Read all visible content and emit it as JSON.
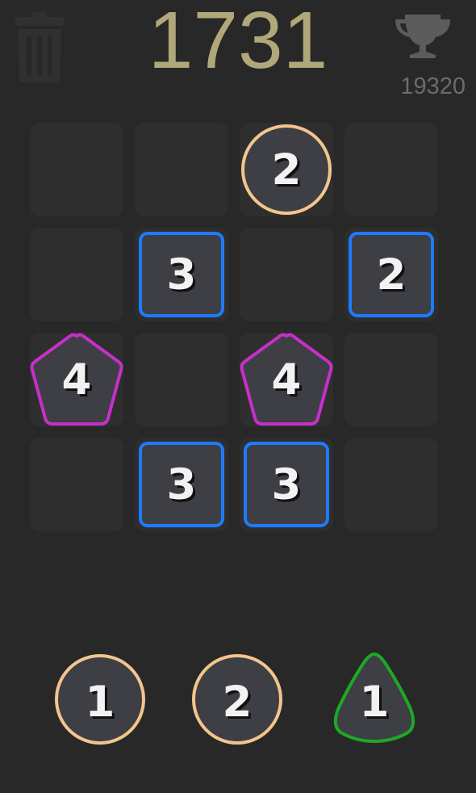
{
  "game": {
    "score": "1731",
    "best_score": "19320"
  },
  "board": {
    "rows": 4,
    "cols": 4,
    "pieces": [
      {
        "row": 0,
        "col": 2,
        "value": "2",
        "shape": "circle"
      },
      {
        "row": 1,
        "col": 1,
        "value": "3",
        "shape": "square"
      },
      {
        "row": 1,
        "col": 3,
        "value": "2",
        "shape": "square"
      },
      {
        "row": 2,
        "col": 0,
        "value": "4",
        "shape": "pentagon"
      },
      {
        "row": 2,
        "col": 2,
        "value": "4",
        "shape": "pentagon"
      },
      {
        "row": 3,
        "col": 1,
        "value": "3",
        "shape": "square"
      },
      {
        "row": 3,
        "col": 2,
        "value": "3",
        "shape": "square"
      }
    ]
  },
  "next_pieces": [
    {
      "value": "1",
      "shape": "circle"
    },
    {
      "value": "2",
      "shape": "circle"
    },
    {
      "value": "1",
      "shape": "triangle"
    }
  ],
  "icons": {
    "trash": "trash-icon",
    "trophy": "trophy-icon"
  },
  "colors": {
    "background": "#282828",
    "cell": "#2e2e2e",
    "piece_fill": "#3e3e45",
    "score": "#b1a87a",
    "circle": "#f3c58e",
    "square": "#1e7bff",
    "pentagon": "#c72fc9",
    "triangle": "#1ea824"
  }
}
